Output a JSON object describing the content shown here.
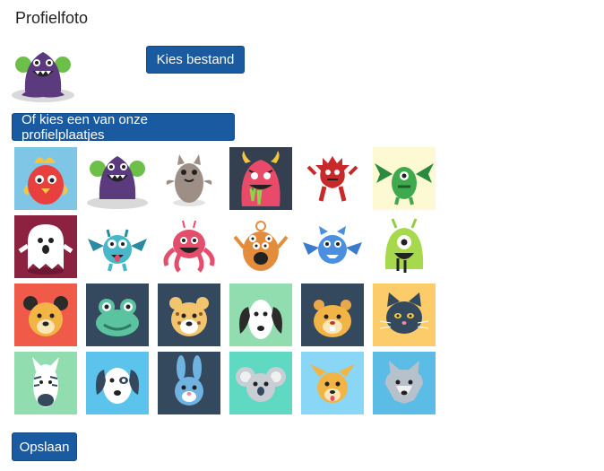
{
  "profile": {
    "title": "Profielfoto",
    "current_avatar": "purple-monster-icon"
  },
  "buttons": {
    "choose_file": "Kies bestand",
    "pick_avatar": "Of kies een van onze profielplaatjes",
    "save": "Opslaan"
  },
  "avatars": [
    {
      "name": "red-bird-monster-icon",
      "bg": "#7fc6e6"
    },
    {
      "name": "purple-monster-icon",
      "bg": "#ffffff"
    },
    {
      "name": "gray-cat-monster-icon",
      "bg": "#ffffff"
    },
    {
      "name": "pink-horned-monster-icon",
      "bg": "#343f4f"
    },
    {
      "name": "red-spiky-monster-icon",
      "bg": "#ffffff"
    },
    {
      "name": "green-winged-monster-icon",
      "bg": "#fdf9d2"
    },
    {
      "name": "ghost-icon",
      "bg": "#8c2140"
    },
    {
      "name": "teal-winged-monster-icon",
      "bg": "#ffffff"
    },
    {
      "name": "pink-octopus-monster-icon",
      "bg": "#ffffff"
    },
    {
      "name": "orange-multi-eye-monster-icon",
      "bg": "#ffffff"
    },
    {
      "name": "blue-bat-monster-icon",
      "bg": "#ffffff"
    },
    {
      "name": "green-cyclops-monster-icon",
      "bg": "#ffffff"
    },
    {
      "name": "bear-icon",
      "bg": "#ef5b48"
    },
    {
      "name": "frog-icon",
      "bg": "#34495e"
    },
    {
      "name": "leopard-icon",
      "bg": "#34495e"
    },
    {
      "name": "dalmatian-dog-icon",
      "bg": "#92ddb0"
    },
    {
      "name": "hamster-icon",
      "bg": "#34495e"
    },
    {
      "name": "black-cat-icon",
      "bg": "#fccc6a"
    },
    {
      "name": "zebra-icon",
      "bg": "#92ddb0"
    },
    {
      "name": "white-dog-icon",
      "bg": "#5bc3ec"
    },
    {
      "name": "rabbit-icon",
      "bg": "#34495e"
    },
    {
      "name": "koala-icon",
      "bg": "#5fd9c1"
    },
    {
      "name": "fox-dog-icon",
      "bg": "#89d6f7"
    },
    {
      "name": "wolf-icon",
      "bg": "#5bbde6"
    }
  ]
}
